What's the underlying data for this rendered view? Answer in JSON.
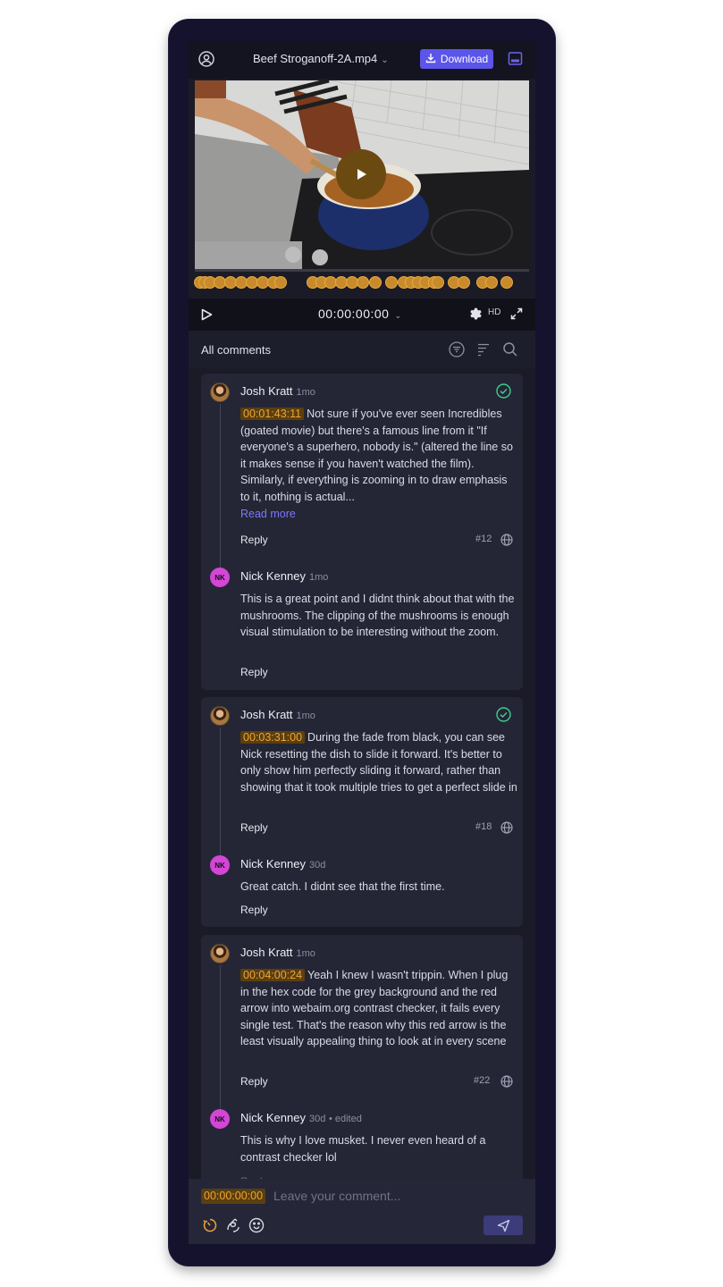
{
  "header": {
    "title": "Beef Stroganoff-2A.mp4",
    "download_label": "Download"
  },
  "player": {
    "timecode": "00:00:00:00",
    "quality": "HD"
  },
  "comments_header": {
    "title": "All comments"
  },
  "threads": [
    {
      "comment": {
        "author": "Josh Kratt",
        "time": "1mo",
        "timestamp": "00:01:43:11",
        "text": "Not sure if you've ever seen Incredibles (goated movie) but there's a famous line from it \"If everyone's a superhero, nobody is.\" (altered the line so it makes sense if you haven't watched the film). Similarly, if everything is zooming in to draw emphasis to it, nothing is actual...",
        "read_more": "Read more",
        "reply": "Reply",
        "number": "#12",
        "resolved": true
      },
      "reply": {
        "initials": "NK",
        "author": "Nick Kenney",
        "time": "1mo",
        "text": "This is a great point and I didnt think about that with the mushrooms. The clipping of the mushrooms is enough visual stimulation to be interesting without the zoom.",
        "reply": "Reply"
      }
    },
    {
      "comment": {
        "author": "Josh Kratt",
        "time": "1mo",
        "timestamp": "00:03:31:00",
        "text": "During the fade from black, you can see Nick resetting the dish to slide it forward. It's better to only show him perfectly sliding it forward, rather than showing that it took multiple tries to get a perfect slide in",
        "reply": "Reply",
        "number": "#18",
        "resolved": true
      },
      "reply": {
        "initials": "NK",
        "author": "Nick Kenney",
        "time": "30d",
        "text": "Great catch. I didnt see that the first time.",
        "reply": "Reply"
      }
    },
    {
      "comment": {
        "author": "Josh Kratt",
        "time": "1mo",
        "timestamp": "00:04:00:24",
        "text": "Yeah I knew I wasn't trippin. When I plug in the hex code for the grey background and the red arrow into webaim.org contrast checker, it fails every single test. That's the reason why this red arrow is the least visually appealing thing to look at in every scene",
        "reply": "Reply",
        "number": "#22",
        "resolved": false
      },
      "reply": {
        "initials": "NK",
        "author": "Nick Kenney",
        "time": "30d",
        "edited": "• edited",
        "text": "This is why I love musket. I never even heard of a contrast checker lol",
        "reply": "Reply"
      }
    }
  ],
  "composer": {
    "timestamp": "00:00:00:00",
    "placeholder": "Leave your comment..."
  },
  "colors": {
    "accent": "#5b55e9",
    "timestamp_bg": "#5a3f10",
    "timestamp_text": "#f0a434",
    "resolved_green": "#3fcf8e",
    "avatar_pink": "#d446d6"
  }
}
